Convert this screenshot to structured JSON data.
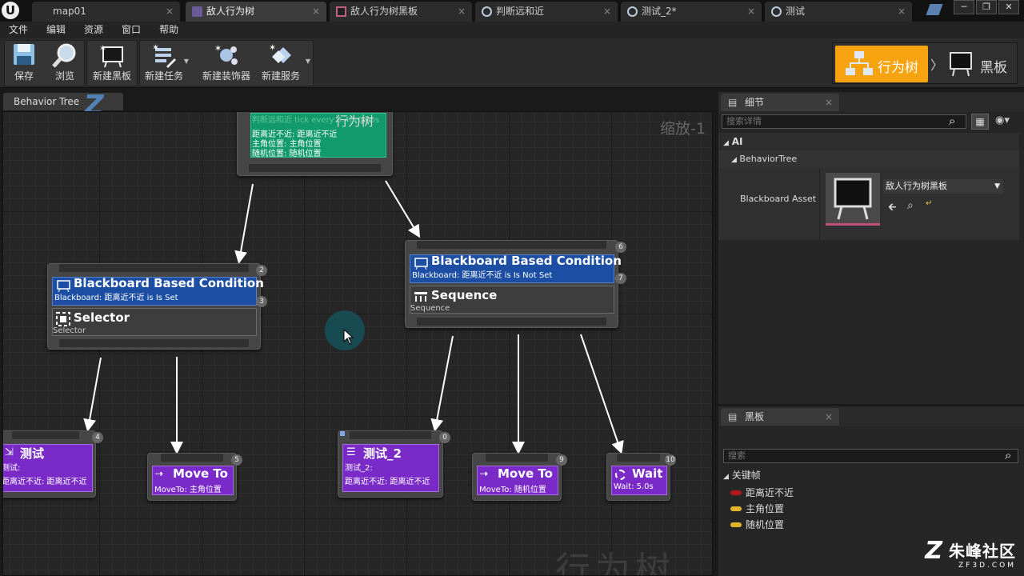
{
  "tabs": [
    {
      "label": "map01"
    },
    {
      "label": "敌人行为树"
    },
    {
      "label": "敌人行为树黑板"
    },
    {
      "label": "判断远和近"
    },
    {
      "label": "测试_2*"
    },
    {
      "label": "测试"
    }
  ],
  "tab_close": "×",
  "window_buttons": [
    "─",
    "❐",
    "✕"
  ],
  "menu": [
    "文件",
    "编辑",
    "资源",
    "窗口",
    "帮助"
  ],
  "toolbar": {
    "save": "保存",
    "browse": "浏览",
    "new_blackboard": "新建黑板",
    "new_task": "新建任务",
    "new_decorator": "新建装饰器",
    "new_service": "新建服务"
  },
  "mode_switch": {
    "behavior_tree": "行为树",
    "separator": "〉",
    "blackboard": "黑板"
  },
  "graph": {
    "tab_label": "Behavior Tree",
    "zoom_label": "缩放-1",
    "watermark": "行为树",
    "root": {
      "title": "行为树",
      "service_line": "判断远和近  tick every 0.40-0.60s",
      "lines": [
        "距离近不近: 距离近不近",
        "主角位置: 主角位置",
        "随机位置: 随机位置"
      ]
    },
    "left_branch": {
      "decorator_title": "Blackboard Based Condition",
      "decorator_sub": "Blackboard: 距离近不近  is Is Set",
      "composite_title": "Selector",
      "composite_sub": "Selector",
      "badge_top": "2",
      "badge_dec": "3"
    },
    "right_branch": {
      "decorator_title": "Blackboard Based Condition",
      "decorator_sub": "Blackboard: 距离近不近  is Is Not Set",
      "composite_title": "Sequence",
      "composite_sub": "Sequence",
      "badge_top": "6",
      "badge_dec": "7"
    },
    "tasks": [
      {
        "title": "测试",
        "sub": "测试:",
        "sub2": "距离近不近: 距离近不近",
        "badge": "4"
      },
      {
        "title": "Move To",
        "sub": "MoveTo: 主角位置",
        "sub2": "",
        "badge": "5"
      },
      {
        "title": "测试_2",
        "sub": "测试_2:",
        "sub2": "距离近不近: 距离近不近",
        "badge": "0"
      },
      {
        "title": "Move To",
        "sub": "MoveTo: 随机位置",
        "sub2": "",
        "badge": "9"
      },
      {
        "title": "Wait",
        "sub": "Wait: 5.0s",
        "sub2": "",
        "badge": "10"
      }
    ]
  },
  "details_panel": {
    "tab_label": "细节",
    "search_placeholder": "搜索详情",
    "section_ai": "AI",
    "section_bt": "BehaviorTree",
    "property_label": "Blackboard Asset",
    "property_value": "敌人行为树黑板"
  },
  "blackboard_panel": {
    "tab_label": "黑板",
    "search_placeholder": "搜索",
    "section": "关键帧",
    "keys": [
      {
        "name": "距离近不近",
        "color": "#b3161a"
      },
      {
        "name": "主角位置",
        "color": "#e2b52a"
      },
      {
        "name": "随机位置",
        "color": "#e2b52a"
      }
    ]
  },
  "watermark": {
    "brand": "朱峰社区",
    "url": "ZF3D.COM"
  }
}
